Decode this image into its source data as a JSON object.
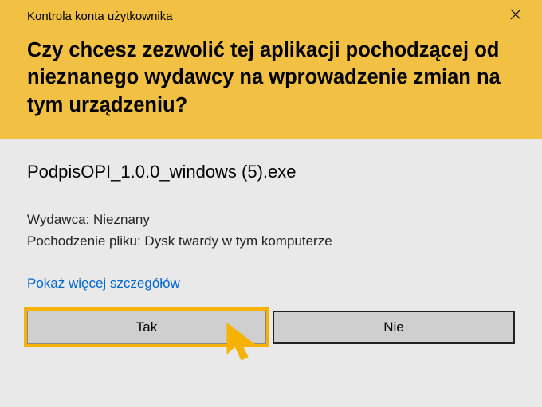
{
  "window": {
    "title": "Kontrola konta użytkownika"
  },
  "heading": "Czy chcesz zezwolić tej aplikacji pochodzącej od nieznanego wydawcy na wprowadzenie zmian na tym urządzeniu?",
  "app_name": "PodpisOPI_1.0.0_windows (5).exe",
  "details": {
    "publisher_line": "Wydawca: Nieznany",
    "origin_line": "Pochodzenie pliku: Dysk twardy w tym komputerze"
  },
  "show_more": "Pokaż więcej szczegółów",
  "buttons": {
    "yes": "Tak",
    "no": "Nie"
  },
  "colors": {
    "accent": "#f2c143",
    "highlight": "#f6b200",
    "link": "#0066cc",
    "body_bg": "#e9e9e9"
  }
}
